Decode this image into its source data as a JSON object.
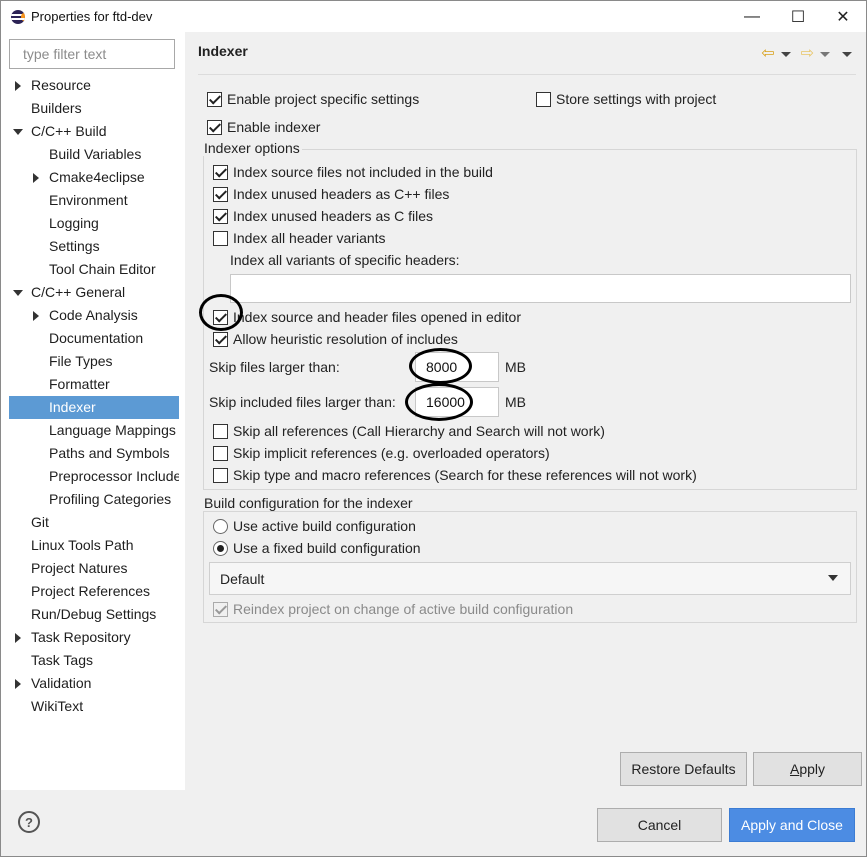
{
  "window": {
    "title": "Properties for ftd-dev",
    "min_glyph": "—",
    "max_glyph": "☐",
    "close_glyph": "✕"
  },
  "filter": {
    "placeholder": "type filter text"
  },
  "tree": [
    {
      "label": "Resource",
      "twisty": "closed",
      "level": 0
    },
    {
      "label": "Builders",
      "twisty": "none",
      "level": 0
    },
    {
      "label": "C/C++ Build",
      "twisty": "open",
      "level": 0
    },
    {
      "label": "Build Variables",
      "twisty": "none",
      "level": 1
    },
    {
      "label": "Cmake4eclipse",
      "twisty": "closed",
      "level": 1
    },
    {
      "label": "Environment",
      "twisty": "none",
      "level": 1
    },
    {
      "label": "Logging",
      "twisty": "none",
      "level": 1
    },
    {
      "label": "Settings",
      "twisty": "none",
      "level": 1
    },
    {
      "label": "Tool Chain Editor",
      "twisty": "none",
      "level": 1
    },
    {
      "label": "C/C++ General",
      "twisty": "open",
      "level": 0
    },
    {
      "label": "Code Analysis",
      "twisty": "closed",
      "level": 1
    },
    {
      "label": "Documentation",
      "twisty": "none",
      "level": 1
    },
    {
      "label": "File Types",
      "twisty": "none",
      "level": 1
    },
    {
      "label": "Formatter",
      "twisty": "none",
      "level": 1
    },
    {
      "label": "Indexer",
      "twisty": "none",
      "level": 1,
      "selected": true
    },
    {
      "label": "Language Mappings",
      "twisty": "none",
      "level": 1
    },
    {
      "label": "Paths and Symbols",
      "twisty": "none",
      "level": 1
    },
    {
      "label": "Preprocessor Include Paths",
      "twisty": "none",
      "level": 1
    },
    {
      "label": "Profiling Categories",
      "twisty": "none",
      "level": 1
    },
    {
      "label": "Git",
      "twisty": "none",
      "level": 0
    },
    {
      "label": "Linux Tools Path",
      "twisty": "none",
      "level": 0
    },
    {
      "label": "Project Natures",
      "twisty": "none",
      "level": 0
    },
    {
      "label": "Project References",
      "twisty": "none",
      "level": 0
    },
    {
      "label": "Run/Debug Settings",
      "twisty": "none",
      "level": 0
    },
    {
      "label": "Task Repository",
      "twisty": "closed",
      "level": 0
    },
    {
      "label": "Task Tags",
      "twisty": "none",
      "level": 0
    },
    {
      "label": "Validation",
      "twisty": "closed",
      "level": 0
    },
    {
      "label": "WikiText",
      "twisty": "none",
      "level": 0
    }
  ],
  "page": {
    "title": "Indexer",
    "nav_back": "⇦",
    "nav_forward": "⇨"
  },
  "settings": {
    "enable_project_specific": {
      "label": "Enable project specific settings",
      "checked": true
    },
    "store_with_project": {
      "label": "Store settings with project",
      "checked": false
    },
    "enable_indexer": {
      "label": "Enable indexer",
      "checked": true
    }
  },
  "indexer_options": {
    "group_label": "Indexer options",
    "items": [
      {
        "label": "Index source files not included in the build",
        "checked": true
      },
      {
        "label": "Index unused headers as C++ files",
        "checked": true
      },
      {
        "label": "Index unused headers as C files",
        "checked": true
      },
      {
        "label": "Index all header variants",
        "checked": false
      }
    ],
    "variants_label": "Index all variants of specific headers:",
    "variants_value": "",
    "items2": [
      {
        "label": "Index source and header files opened in editor",
        "checked": true
      },
      {
        "label": "Allow heuristic resolution of includes",
        "checked": true
      }
    ],
    "skip_files_label": "Skip files larger than:",
    "skip_files_value": "8000",
    "skip_included_label": "Skip included files larger than:",
    "skip_included_value": "16000",
    "unit": "MB",
    "refs": [
      {
        "label": "Skip all references (Call Hierarchy and Search will not work)",
        "checked": false
      },
      {
        "label": "Skip implicit references (e.g. overloaded operators)",
        "checked": false
      },
      {
        "label": "Skip type and macro references (Search for these references will not work)",
        "checked": false
      }
    ]
  },
  "build_config": {
    "group_label": "Build configuration for the indexer",
    "use_active": {
      "label": "Use active build configuration",
      "checked": false
    },
    "use_fixed": {
      "label": "Use a fixed build configuration",
      "checked": true
    },
    "selected_config": "Default",
    "reindex": {
      "label": "Reindex project on change of active build configuration",
      "checked": true,
      "disabled": true
    }
  },
  "buttons": {
    "restore_defaults": "Restore Defaults",
    "apply": "Apply",
    "cancel": "Cancel",
    "apply_and_close": "Apply and Close",
    "help": "?"
  }
}
